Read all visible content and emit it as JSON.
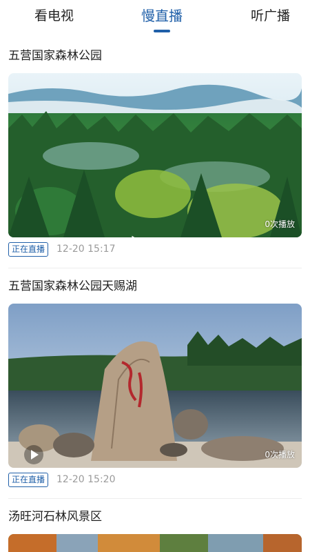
{
  "tabs": [
    {
      "label": "看电视"
    },
    {
      "label": "慢直播"
    },
    {
      "label": "听广播"
    }
  ],
  "feed": [
    {
      "title": "五营国家森林公园",
      "play_count": "0次播放",
      "status": "正在直播",
      "time": "12-20 15:17"
    },
    {
      "title": "五营国家森林公园天赐湖",
      "play_count": "0次播放",
      "status": "正在直播",
      "time": "12-20 15:20"
    },
    {
      "title": "汤旺河石林风景区"
    }
  ],
  "colors": {
    "accent": "#1f5fa8",
    "meta_text": "#9a9a9a"
  }
}
